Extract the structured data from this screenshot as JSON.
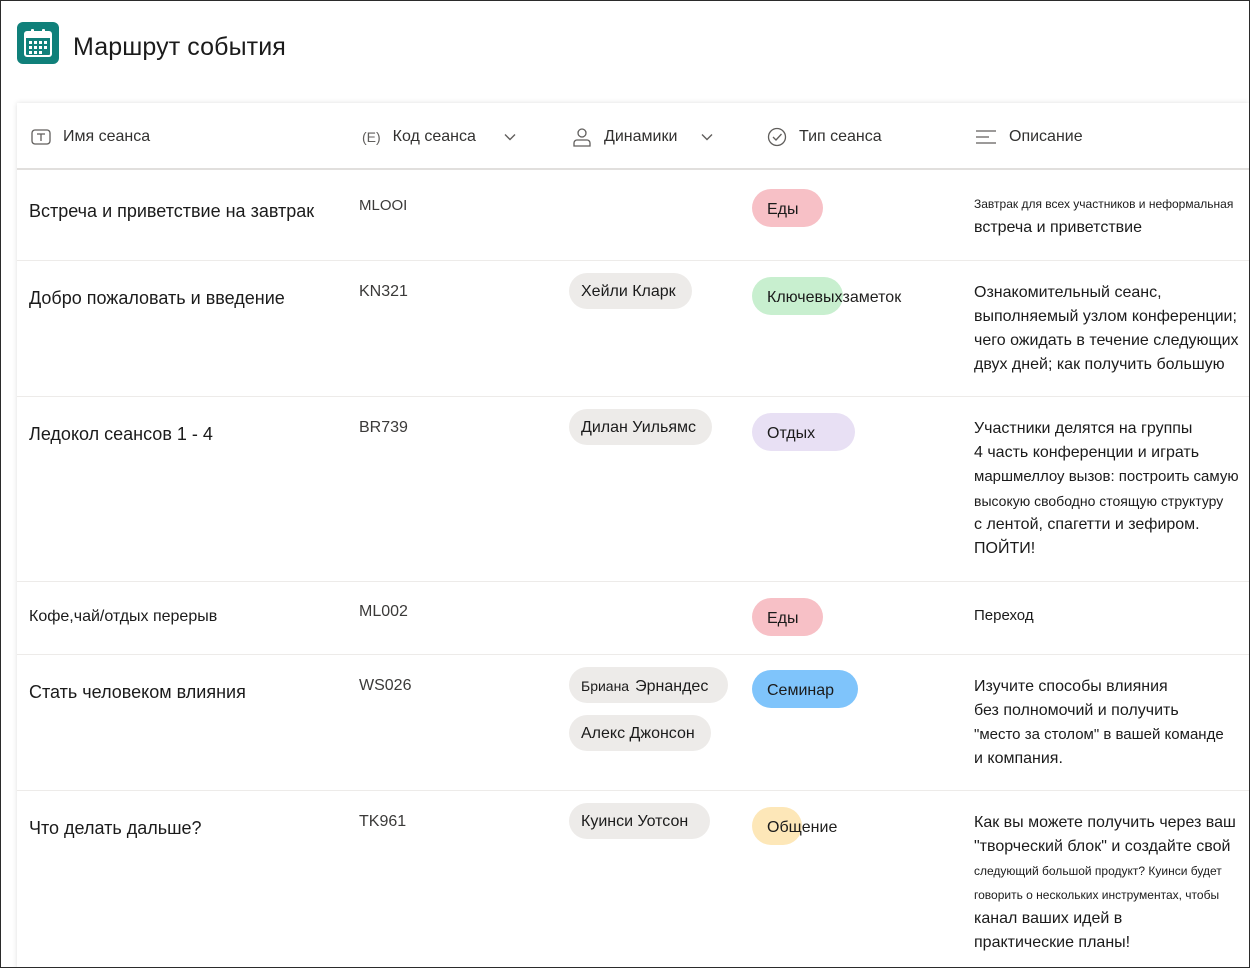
{
  "app": {
    "title": "Маршрут события",
    "icon": "calendar-icon",
    "accent": "#10807a"
  },
  "columns": [
    {
      "label": "Имя сеанса",
      "icon": "text-field-icon"
    },
    {
      "label": "Код сеанса",
      "icon_text": "(E)",
      "sortable": true
    },
    {
      "label": "Динамики",
      "icon": "person-icon",
      "sortable": true
    },
    {
      "label": "Тип сеанса",
      "icon": "check-circle-icon"
    },
    {
      "label": "Описание",
      "icon": "text-lines-icon"
    }
  ],
  "type_colors": {
    "Еды": "#f7c0c6",
    "Ключевых заметок": "#c8efcf",
    "Отдых": "#e8e0f4",
    "Семинар": "#7fc4fb",
    "Общение": "#fde7b8"
  },
  "rows": [
    {
      "name": "Встреча и приветствие на завтрак",
      "code": "MLOOI",
      "speakers": [],
      "type": "Еды",
      "type_tail": "",
      "desc": [
        "Завтрак для всех участников и неформальная",
        "встреча и приветствие"
      ]
    },
    {
      "name": "Добро пожаловать и введение",
      "code": "KN321",
      "speakers": [
        "Хейли Кларк"
      ],
      "type": "Ключевых",
      "type_tail": "заметок",
      "desc": [
        "Ознакомительный сеанс,",
        "выполняемый узлом конференции;",
        "чего ожидать в течение следующих",
        "двух дней; как получить большую"
      ]
    },
    {
      "name": "Ледокол сеансов 1 - 4",
      "code": "BR739",
      "speakers": [
        "Дилан Уильямс"
      ],
      "type": "Отдых",
      "type_tail": "",
      "desc": [
        "Участники делятся на группы",
        "4 часть конференции и играть",
        "маршмеллоу вызов: построить самую",
        "высокую свободно стоящую структуру",
        "с лентой, спагетти и зефиром.",
        "ПОЙТИ!"
      ]
    },
    {
      "name": "Кофе,чай/отдых перерыв",
      "code": "ML002",
      "speakers": [],
      "type": "Еды",
      "type_tail": "",
      "desc": [
        "Переход"
      ]
    },
    {
      "name": "Стать человеком влияния",
      "code": "WS026",
      "speakers_first_small": "Бриана",
      "speakers": [
        "Эрнандес",
        "Алекс Джонсон"
      ],
      "type": "Семинар",
      "type_tail": "",
      "desc": [
        "Изучите способы влияния",
        "без полномочий и получить",
        "\"место за столом\" в вашей команде",
        "и компания."
      ]
    },
    {
      "name": "Что делать дальше?",
      "code": "TK961",
      "speakers": [
        "Куинси Уотсон"
      ],
      "type": "Общ",
      "type_tail": "ение",
      "desc": [
        "Как вы можете получить через ваш",
        "\"творческий блок\" и создайте свой",
        "следующий большой продукт? Куинси будет",
        "говорить о нескольких инструментах, чтобы",
        "канал ваших идей в",
        "практические планы!"
      ]
    }
  ]
}
